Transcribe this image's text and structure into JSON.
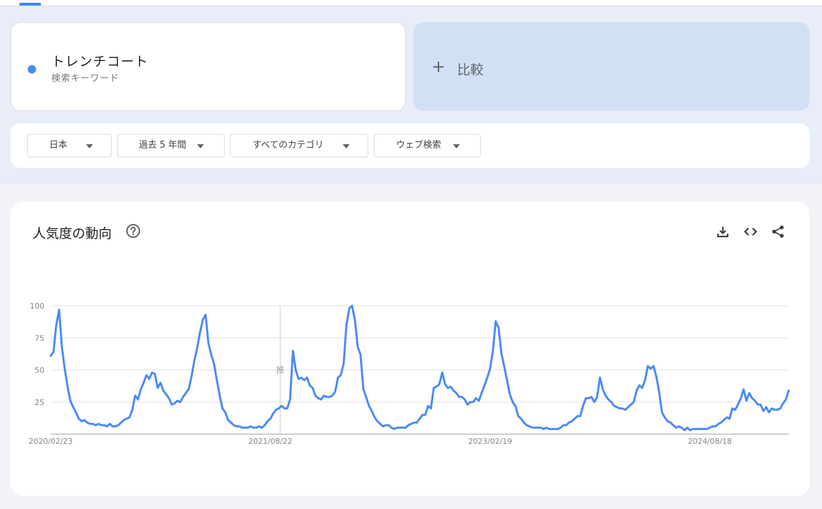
{
  "search_term": {
    "name": "トレンチコート",
    "type_label": "検索キーワード",
    "color": "#4a8af4"
  },
  "compare": {
    "plus": "+",
    "label": "比較"
  },
  "filters": [
    {
      "label": "日本"
    },
    {
      "label": "過去 5 年間"
    },
    {
      "label": "すべてのカテゴリ"
    },
    {
      "label": "ウェブ検索"
    }
  ],
  "chart_header": {
    "title": "人気度の動向",
    "icons": [
      "help-icon",
      "download-icon",
      "embed-code-icon",
      "share-icon"
    ]
  },
  "chart_data": {
    "type": "line",
    "ylim": [
      0,
      100
    ],
    "yticks": [
      25,
      50,
      75,
      100
    ],
    "grid": true,
    "legend": "none",
    "xlabel": "",
    "ylabel": "",
    "xtick_labels": [
      "2020/02/23",
      "2021/08/22",
      "2023/02/19",
      "2024/08/18"
    ],
    "marker_label": "推",
    "x_start": "2020/02/23",
    "x_step": "1 week",
    "series": [
      {
        "color": "#4a8af4",
        "values": [
          61,
          64,
          85,
          97,
          68,
          51,
          37,
          26,
          21,
          17,
          12,
          10,
          11,
          9,
          8,
          8,
          7,
          8,
          7,
          7,
          6,
          8,
          6,
          6,
          7,
          9,
          11,
          12,
          13,
          19,
          30,
          27,
          35,
          40,
          46,
          43,
          48,
          47,
          36,
          40,
          34,
          31,
          28,
          23,
          24,
          26,
          25,
          29,
          32,
          35,
          45,
          57,
          67,
          79,
          89,
          93,
          71,
          62,
          55,
          42,
          30,
          20,
          17,
          11,
          9,
          7,
          6,
          6,
          5,
          5,
          5,
          6,
          5,
          5,
          6,
          5,
          7,
          10,
          12,
          16,
          19,
          20,
          22,
          20,
          20,
          27,
          65,
          50,
          43,
          44,
          42,
          44,
          38,
          36,
          30,
          28,
          27,
          30,
          29,
          29,
          30,
          33,
          44,
          46,
          55,
          85,
          98,
          100,
          89,
          68,
          62,
          35,
          29,
          22,
          18,
          13,
          10,
          8,
          6,
          7,
          7,
          5,
          4,
          5,
          5,
          5,
          5,
          7,
          8,
          9,
          9,
          12,
          15,
          15,
          22,
          20,
          36,
          37,
          39,
          48,
          39,
          36,
          37,
          34,
          32,
          29,
          29,
          27,
          23,
          25,
          25,
          28,
          26,
          32,
          38,
          44,
          51,
          65,
          88,
          83,
          63,
          53,
          42,
          31,
          25,
          22,
          14,
          12,
          9,
          7,
          6,
          5,
          5,
          5,
          5,
          4,
          5,
          4,
          4,
          4,
          4,
          5,
          7,
          7,
          9,
          10,
          12,
          14,
          14,
          22,
          28,
          28,
          29,
          25,
          29,
          44,
          35,
          30,
          27,
          25,
          22,
          21,
          20,
          20,
          19,
          21,
          23,
          25,
          34,
          38,
          36,
          42,
          53,
          51,
          53,
          45,
          33,
          17,
          13,
          10,
          9,
          7,
          5,
          6,
          5,
          3,
          5,
          3,
          4,
          4,
          4,
          4,
          4,
          4,
          5,
          6,
          6,
          8,
          9,
          11,
          13,
          12,
          20,
          19,
          23,
          28,
          35,
          26,
          32,
          28,
          26,
          23,
          23,
          18,
          21,
          17,
          20,
          19,
          19,
          20,
          24,
          27,
          34
        ]
      }
    ]
  }
}
